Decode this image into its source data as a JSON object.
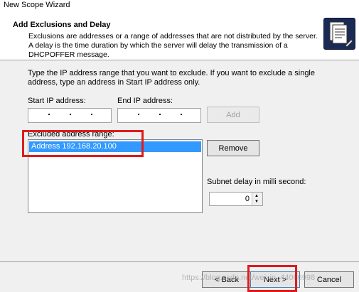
{
  "window": {
    "title": "New Scope Wizard"
  },
  "header": {
    "heading": "Add Exclusions and Delay",
    "description": "Exclusions are addresses or a range of addresses that are not distributed by the server. A delay is the time duration by which the server will delay the transmission of a DHCPOFFER message.",
    "icon": "wizard-icon"
  },
  "form": {
    "instructions": "Type the IP address range that you want to exclude. If you want to exclude a single address, type an address in Start IP address only.",
    "start_ip_label": "Start IP address:",
    "end_ip_label": "End IP address:",
    "add_label": "Add",
    "excluded_label": "Excluded address range:",
    "excluded_items": [
      "Address 192.168.20.100"
    ],
    "remove_label": "Remove",
    "delay_label": "Subnet delay in milli second:",
    "delay_value": "0"
  },
  "footer": {
    "back_label": "< Back",
    "next_label": "Next >",
    "cancel_label": "Cancel",
    "watermark": "https://blog.csdn.net/weixin_44066998"
  },
  "colors": {
    "selection": "#3399ff",
    "highlight_box": "#e11a1a"
  }
}
